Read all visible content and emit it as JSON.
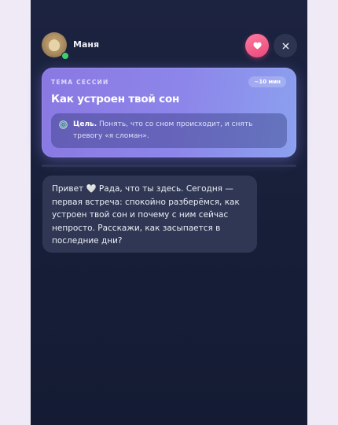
{
  "header": {
    "name": "Маня",
    "online": true
  },
  "topic": {
    "label": "ТЕМА СЕССИИ",
    "duration": "~10 мин",
    "title": "Как устроен твой сон",
    "goal_label": "Цель.",
    "goal_text": "Понять, что со сном происходит, и снять тревогу «я сломан»."
  },
  "messages": [
    {
      "before_emoji": "Привет",
      "emoji": "🤍",
      "after_emoji": "Рада, что ты здесь. Сегодня — первая встреча: спокойно разберёмся, как устроен твой сон и почему с ним сейчас непросто. Расскажи, как засыпается в последние дни?"
    }
  ],
  "icons": {
    "heart_button": "heart-icon",
    "close_button": "close-icon",
    "goal": "target-icon"
  },
  "colors": {
    "page_bg": "#efeaf6",
    "app_bg": "#1c2340",
    "accent_pink": "#e8487b",
    "card_gradient_start": "#8a78e2",
    "card_gradient_end": "#8ba1ef",
    "bubble_bg": "#2f3754",
    "online": "#3ed06b"
  }
}
